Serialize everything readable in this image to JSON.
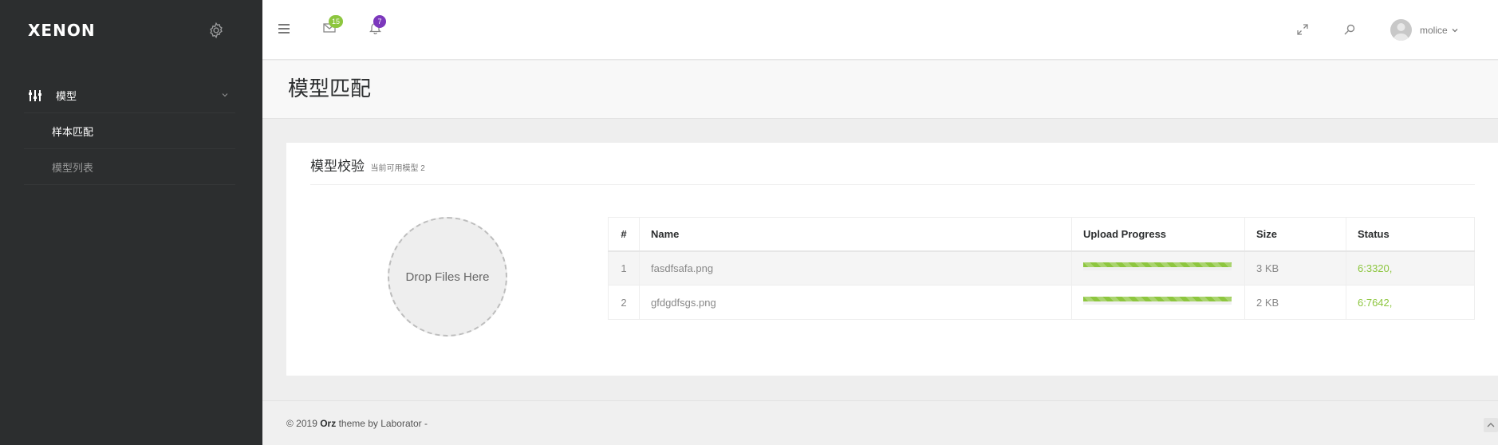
{
  "sidebar": {
    "logo": "XENON",
    "settings_icon": "gear-icon",
    "menu": {
      "parent_label": "模型",
      "parent_icon": "sliders-icon",
      "items": [
        {
          "label": "样本匹配",
          "active": true
        },
        {
          "label": "模型列表",
          "active": false
        }
      ]
    }
  },
  "topbar": {
    "menu_icon": "hamburger-icon",
    "messages_badge": "15",
    "notifications_badge": "7",
    "user_name": "molice",
    "icons": [
      "expand-icon",
      "search-icon"
    ]
  },
  "page": {
    "title": "模型匹配"
  },
  "panel": {
    "title": "模型校验",
    "subtitle": "当前可用模型 2",
    "dropzone_text": "Drop Files Here"
  },
  "table": {
    "headers": [
      "#",
      "Name",
      "Upload Progress",
      "Size",
      "Status"
    ],
    "rows": [
      {
        "num": "1",
        "name": "fasdfsafa.png",
        "progress": 1.0,
        "size": "3 KB",
        "status": "6:3320,"
      },
      {
        "num": "2",
        "name": "gfdgdfsgs.png",
        "progress": 1.0,
        "size": "2 KB",
        "status": "6:7642,"
      }
    ]
  },
  "footer": {
    "prefix": "© 2019 ",
    "brand": "Orz",
    "suffix": " theme by Laborator -"
  },
  "colors": {
    "sidebar_bg": "#2c2e2f",
    "accent_green": "#8dc63f",
    "badge_purple": "#7c38bc"
  }
}
